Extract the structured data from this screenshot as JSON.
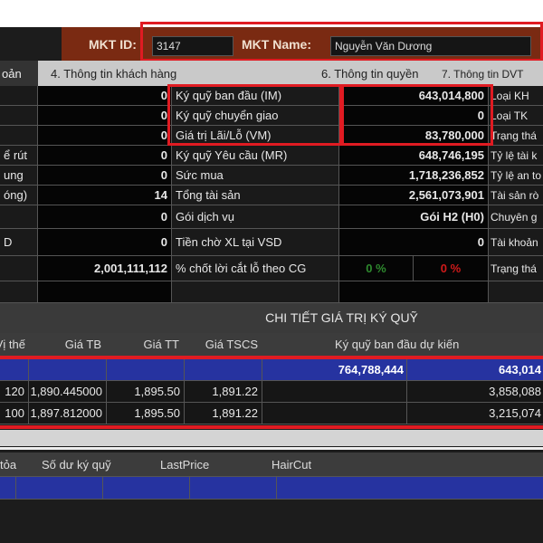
{
  "mkt": {
    "id_label": "MKT ID:",
    "id_value": "3147",
    "name_label": "MKT Name:",
    "name_value": "Nguyễn Văn Dương"
  },
  "tabs": [
    "oản",
    "4. Thông tin khách hàng",
    "6. Thông tin quyền",
    "7. Thông tin DVT"
  ],
  "summary_rows": [
    {
      "c0": "",
      "c1": "0",
      "c2": "Ký quỹ ban đầu (IM)",
      "c3": "643,014,800",
      "c4": "Loại KH"
    },
    {
      "c0": "",
      "c1": "0",
      "c2": "Ký quỹ chuyển giao",
      "c3": "0",
      "c4": "Loại TK"
    },
    {
      "c0": "",
      "c1": "0",
      "c2": "Giá trị Lãi/Lỗ (VM)",
      "c3": "83,780,000",
      "c4": "Trạng thá"
    },
    {
      "c0": "ể rút",
      "c1": "0",
      "c2": "Ký quỹ Yêu cầu (MR)",
      "c3": "648,746,195",
      "c4": "Tỷ lệ tài k"
    },
    {
      "c0": "ung",
      "c1": "0",
      "c2": "Sức mua",
      "c3": "1,718,236,852",
      "c4": "Tỷ lệ an to"
    },
    {
      "c0": "óng)",
      "c1": "14",
      "c2": "Tổng tài sản",
      "c3": "2,561,073,901",
      "c4": "Tài sản rò"
    },
    {
      "c0": "",
      "c1": "0",
      "c2": "Gói dịch vụ",
      "c3": "Gói H2 (H0)",
      "c4": "Chuyên g"
    },
    {
      "c0": "D",
      "c1": "0",
      "c2": "Tiền chờ XL tại VSD",
      "c3": "0",
      "c4": "Tài khoản"
    },
    {
      "c0": "",
      "c1": "2,001,111,112",
      "c2": "% chốt lời cắt lỗ theo CG",
      "c3a": "0 %",
      "c3b": "0 %",
      "c4": "Trạng thá"
    }
  ],
  "colors": {
    "profit": "#2e8b2e",
    "loss": "#d01a1a",
    "accent_red": "#e01b22",
    "row_blue": "#2633a0"
  },
  "margin_detail": {
    "title": "CHI TIẾT GIÁ TRỊ KÝ QUỸ",
    "headers": [
      "Vị thế",
      "Giá TB",
      "Giá TT",
      "Giá TSCS",
      "Ký quỹ ban đầu dự kiến"
    ],
    "total_row": {
      "expected_im": "764,788,444",
      "im": "643,014"
    },
    "rows": [
      {
        "position": "120",
        "avg": "1,890.445000",
        "market": "1,895.50",
        "tscs": "1,891.22",
        "im": "3,858,088"
      },
      {
        "position": "100",
        "avg": "1,897.812000",
        "market": "1,895.50",
        "tscs": "1,891.22",
        "im": "3,215,074"
      }
    ]
  },
  "collateral": {
    "headers": [
      "tỏa",
      "Số dư ký quỹ",
      "LastPrice",
      "HairCut"
    ]
  }
}
